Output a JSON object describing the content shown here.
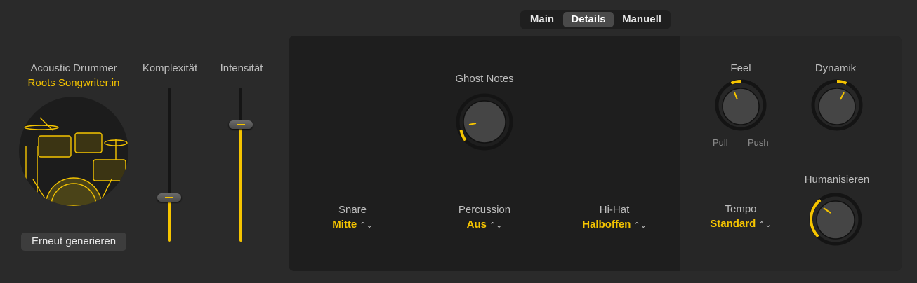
{
  "tabs": [
    {
      "label": "Main",
      "active": false
    },
    {
      "label": "Details",
      "active": true
    },
    {
      "label": "Manuell",
      "active": false
    }
  ],
  "drummer": {
    "name": "Acoustic Drummer",
    "kit": "Roots Songwriter:in",
    "regenerate_label": "Erneut generieren"
  },
  "sliders": {
    "complexity": {
      "label": "Komplexität",
      "value": 0.29
    },
    "intensity": {
      "label": "Intensität",
      "value": 0.76
    }
  },
  "details": {
    "ghost_notes": {
      "label": "Ghost Notes",
      "value": 0.12
    },
    "snare": {
      "label": "Snare",
      "value": "Mitte"
    },
    "percussion": {
      "label": "Percussion",
      "value": "Aus"
    },
    "hihat": {
      "label": "Hi-Hat",
      "value": "Halboffen"
    },
    "feel": {
      "label": "Feel",
      "value": 0.45,
      "left_label": "Pull",
      "right_label": "Push"
    },
    "dynamics": {
      "label": "Dynamik",
      "value": 0.6
    },
    "tempo": {
      "label": "Tempo",
      "value": "Standard"
    },
    "humanize": {
      "label": "Humanisieren",
      "value": 0.35
    }
  },
  "colors": {
    "accent": "#f5c400",
    "panel": "#1e1e1e",
    "background": "#2a2a2a"
  }
}
